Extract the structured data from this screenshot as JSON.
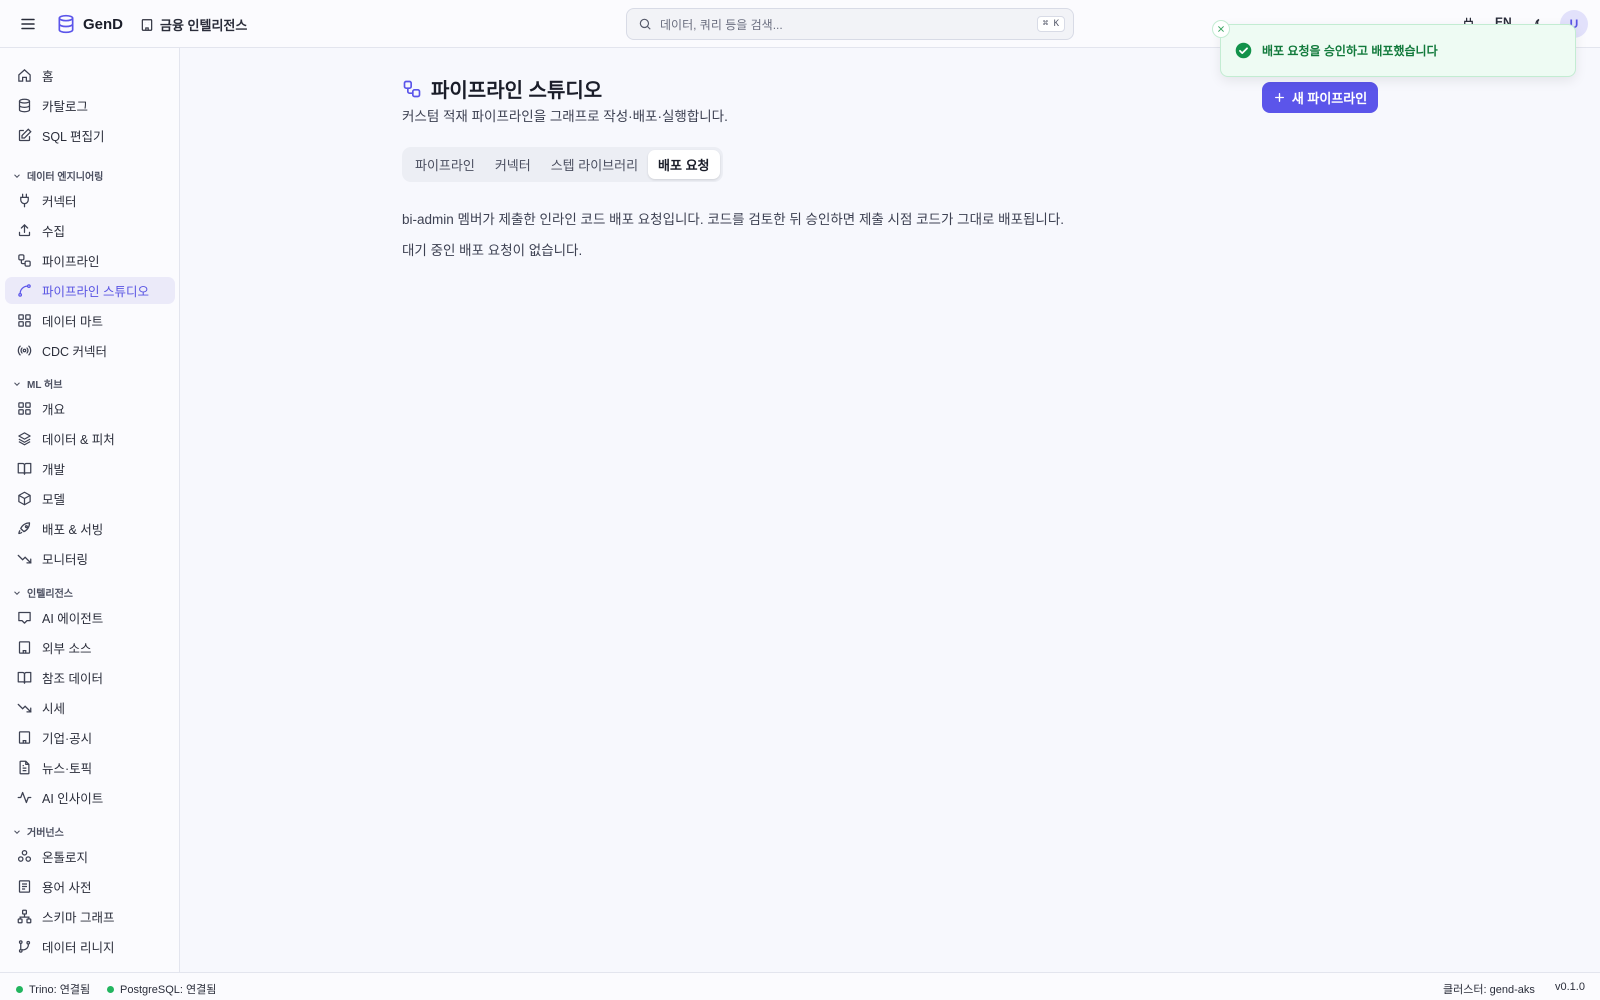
{
  "header": {
    "app_name": "GenD",
    "workspace": "금융 인텔리전스",
    "search_placeholder": "데이터, 쿼리 등을 검색...",
    "search_shortcut": "⌘ K",
    "language": "EN",
    "avatar_initial": "U"
  },
  "sidebar": {
    "top_items": [
      {
        "label": "홈",
        "icon": "home-icon"
      },
      {
        "label": "카탈로그",
        "icon": "database-icon"
      },
      {
        "label": "SQL 편집기",
        "icon": "edit-icon"
      }
    ],
    "sections": [
      {
        "title": "데이터 엔지니어링",
        "items": [
          {
            "label": "커넥터",
            "icon": "plug-icon"
          },
          {
            "label": "수집",
            "icon": "upload-icon"
          },
          {
            "label": "파이프라인",
            "icon": "workflow-icon"
          },
          {
            "label": "파이프라인 스튜디오",
            "icon": "spline-icon",
            "active": true
          },
          {
            "label": "데이터 마트",
            "icon": "grid-icon"
          },
          {
            "label": "CDC 커넥터",
            "icon": "radio-icon"
          }
        ]
      },
      {
        "title": "ML 허브",
        "items": [
          {
            "label": "개요",
            "icon": "grid-icon"
          },
          {
            "label": "데이터 & 피처",
            "icon": "layers-icon"
          },
          {
            "label": "개발",
            "icon": "book-icon"
          },
          {
            "label": "모델",
            "icon": "box-icon"
          },
          {
            "label": "배포 & 서빙",
            "icon": "rocket-icon"
          },
          {
            "label": "모니터링",
            "icon": "trend-down-icon"
          }
        ]
      },
      {
        "title": "인텔리전스",
        "items": [
          {
            "label": "AI 에이전트",
            "icon": "message-icon"
          },
          {
            "label": "외부 소스",
            "icon": "building-icon"
          },
          {
            "label": "참조 데이터",
            "icon": "book-icon"
          },
          {
            "label": "시세",
            "icon": "trend-down-icon"
          },
          {
            "label": "기업·공시",
            "icon": "building-icon"
          },
          {
            "label": "뉴스·토픽",
            "icon": "file-text-icon"
          },
          {
            "label": "AI 인사이트",
            "icon": "activity-icon"
          }
        ]
      },
      {
        "title": "거버넌스",
        "items": [
          {
            "label": "온톨로지",
            "icon": "boxes-icon"
          },
          {
            "label": "용어 사전",
            "icon": "list-icon"
          },
          {
            "label": "스키마 그래프",
            "icon": "network-icon"
          },
          {
            "label": "데이터 리니지",
            "icon": "git-branch-icon"
          }
        ]
      }
    ]
  },
  "main": {
    "title": "파이프라인 스튜디오",
    "subtitle": "커스텀 적재 파이프라인을 그래프로 작성·배포·실행합니다.",
    "new_button": "새 파이프라인",
    "tabs": [
      "파이프라인",
      "커넥터",
      "스텝 라이브러리",
      "배포 요청"
    ],
    "active_tab": "배포 요청",
    "description": "bi-admin 멤버가 제출한 인라인 코드 배포 요청입니다. 코드를 검토한 뒤 승인하면 제출 시점 코드가 그대로 배포됩니다.",
    "empty_message": "대기 중인 배포 요청이 없습니다."
  },
  "toast": {
    "message": "배포 요청을 승인하고 배포했습니다"
  },
  "statusbar": {
    "trino": "Trino: 연결됨",
    "postgres": "PostgreSQL: 연결됨",
    "cluster": "클러스터: gend-aks",
    "version": "v0.1.0"
  },
  "colors": {
    "accent": "#5b55ea",
    "active_bg": "#ebeaf9",
    "success": "#22b55f",
    "toast_bg": "#eefbf3"
  }
}
